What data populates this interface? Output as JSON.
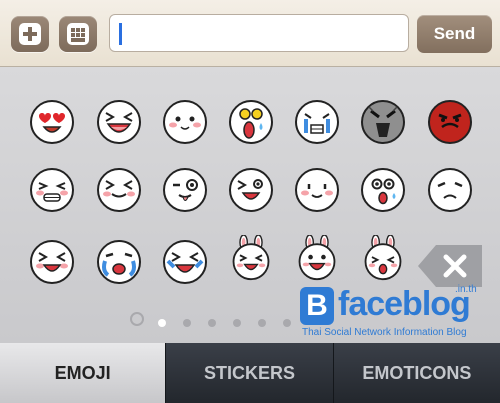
{
  "toolbar": {
    "add_icon": "plus-icon",
    "keyboard_icon": "keyboard-icon",
    "input_value": "",
    "input_placeholder": "",
    "send_label": "Send"
  },
  "emoji_panel": {
    "rows": [
      [
        "heart-eyes",
        "laughing",
        "blushing",
        "shocked-sweat",
        "crying",
        "dark-shocked",
        "angry-red"
      ],
      [
        "squint-grin",
        "xd-laugh",
        "wink-tongue",
        "wink-grin",
        "smile",
        "surprised",
        "sad"
      ],
      [
        "laugh-cry",
        "tears-crying",
        "tears-laugh",
        "bunny-grin",
        "bunny-laugh",
        "bunny-surprised"
      ]
    ],
    "delete_icon": "backspace-icon",
    "page_count": 6,
    "active_page": 1,
    "recent_icon": "clock-icon"
  },
  "watermark": {
    "title": "faceblog",
    "tld": ".in.th",
    "subtitle": "Thai Social Network Information Blog"
  },
  "tabs": [
    {
      "label": "EMOJI",
      "active": true
    },
    {
      "label": "STICKERS",
      "active": false
    },
    {
      "label": "EMOTICONS",
      "active": false
    }
  ],
  "colors": {
    "toolbar_brown": "#826f5e",
    "caret_blue": "#2a6fe0",
    "watermark_blue": "#2f7bd4",
    "tab_dark": "#2a2e35"
  }
}
